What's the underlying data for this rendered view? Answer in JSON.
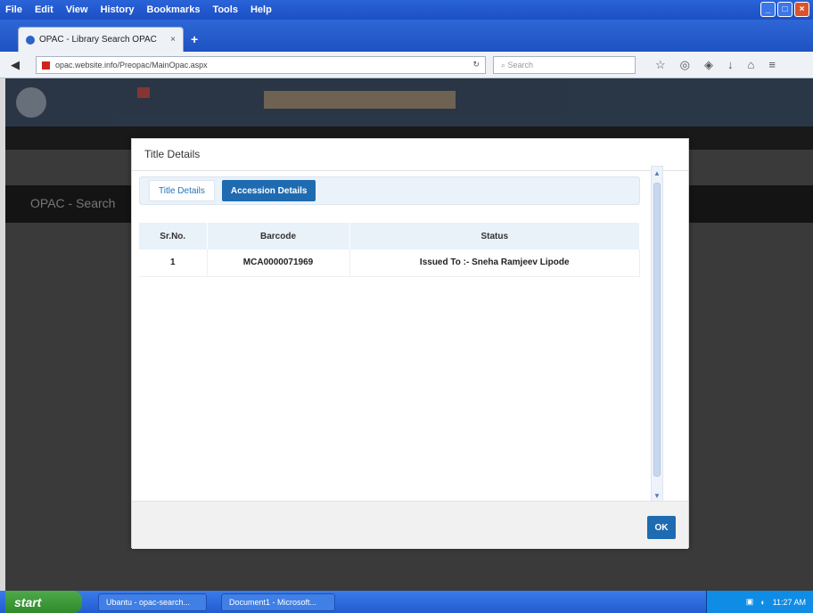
{
  "browser": {
    "menu": [
      "File",
      "Edit",
      "View",
      "History",
      "Bookmarks",
      "Tools",
      "Help"
    ],
    "tab_title": "OPAC - Library Search OPAC",
    "url": "opac.website.info/Preopac/MainOpac.aspx",
    "search_placeholder": "Search"
  },
  "modal": {
    "title": "Title Details",
    "tabs": [
      {
        "label": "Title Details"
      },
      {
        "label": "Accession Details"
      }
    ],
    "table": {
      "headers": [
        "Sr.No.",
        "Barcode",
        "Status"
      ],
      "rows": [
        [
          "1",
          "MCA0000071969",
          "Issued To :- Sneha Ramjeev Lipode"
        ]
      ]
    },
    "ok_label": "OK"
  },
  "page": {
    "band_text": "OPAC - Search"
  },
  "taskbar": {
    "start_label": "start",
    "items": [
      "Ubantu - opac-search...",
      "Document1 - Microsoft..."
    ],
    "clock": "11:27 AM"
  },
  "colors": {
    "accent": "#1f6bb2",
    "taskbar": "#235cd0",
    "start": "#2f8a2c"
  }
}
